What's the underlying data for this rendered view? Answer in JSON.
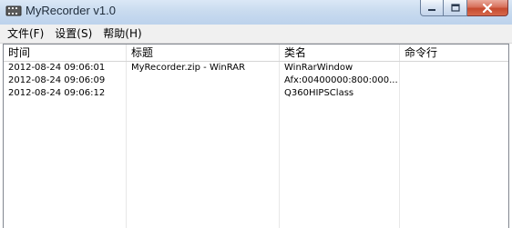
{
  "window": {
    "title": "MyRecorder v1.0",
    "icon": "film-strip-icon",
    "buttons": [
      "minimize-icon",
      "maximize-icon",
      "close-icon"
    ]
  },
  "menu": {
    "items": [
      "文件(F)",
      "设置(S)",
      "帮助(H)"
    ]
  },
  "table": {
    "columns": [
      "时间",
      "标题",
      "类名",
      "命令行"
    ],
    "rows": [
      [
        "2012-08-24 09:06:01",
        "MyRecorder.zip - WinRAR",
        "WinRarWindow",
        ""
      ],
      [
        "2012-08-24 09:06:09",
        "",
        "Afx:00400000:800:000...",
        ""
      ],
      [
        "2012-08-24 09:06:12",
        "",
        "Q360HIPSClass",
        ""
      ]
    ]
  },
  "colors": {
    "titlebar": "#c9dbef",
    "close_button": "#c64a2f",
    "menubar": "#f0f0f0"
  }
}
